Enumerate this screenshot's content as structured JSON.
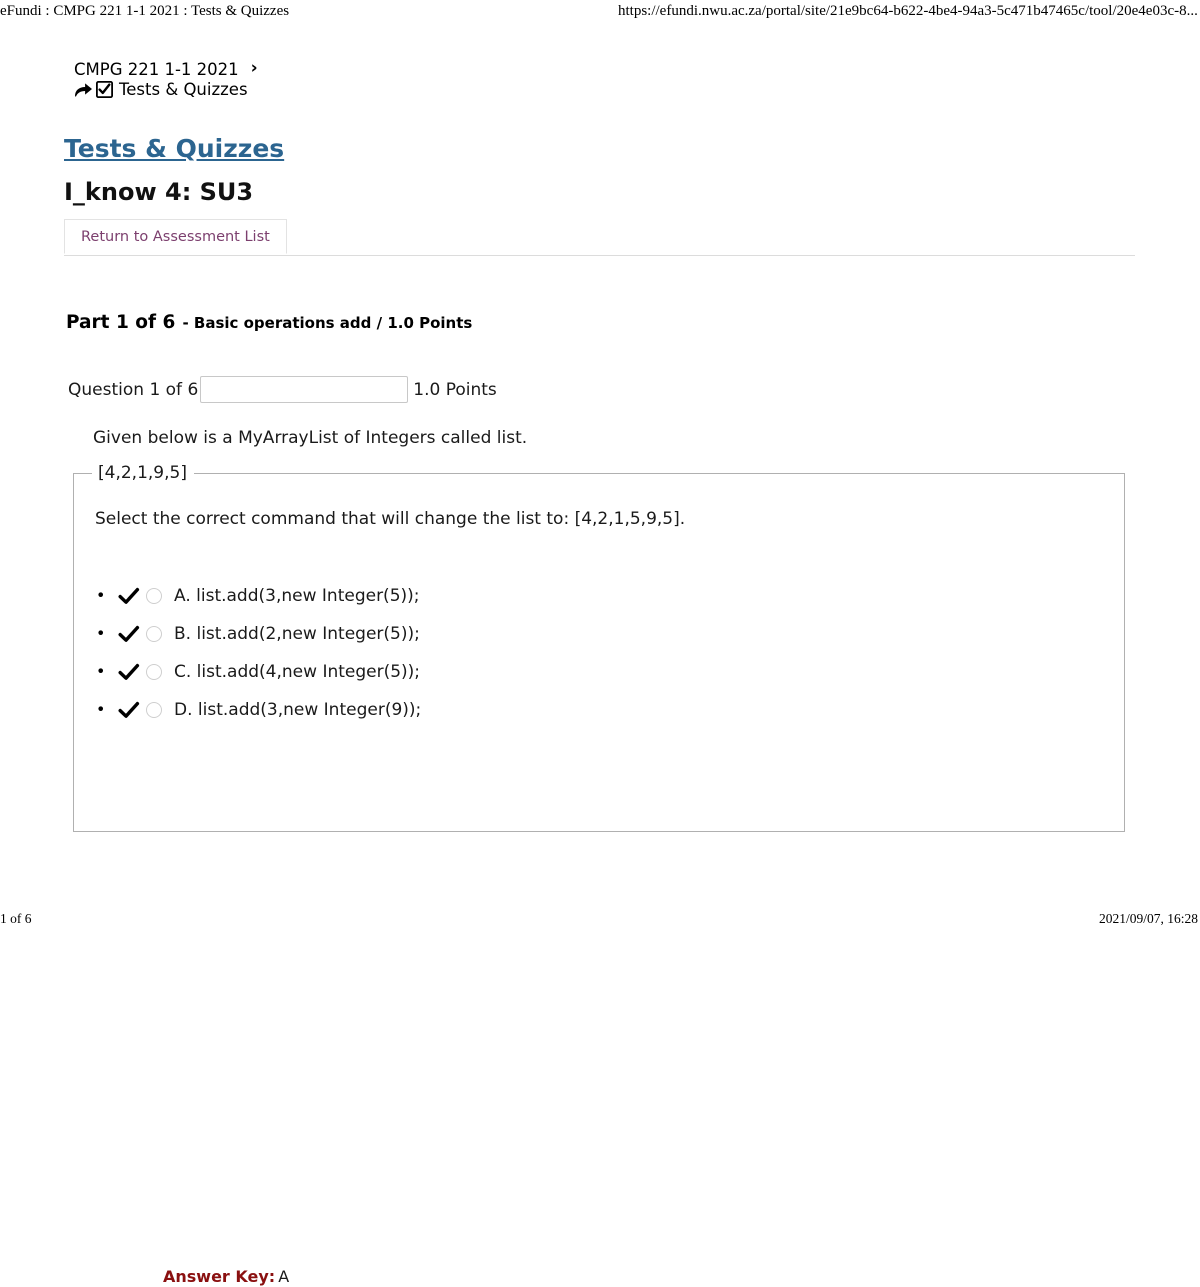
{
  "print": {
    "header_left": "eFundi : CMPG 221 1-1 2021 : Tests & Quizzes",
    "header_right": "https://efundi.nwu.ac.za/portal/site/21e9bc64-b622-4be4-94a3-5c471b47465c/tool/20e4e03c-8...",
    "footer_left": "1 of 6",
    "footer_right": "2021/09/07, 16:28"
  },
  "breadcrumb": {
    "site": "CMPG 221 1-1 2021",
    "separator": "›",
    "tool": "Tests & Quizzes",
    "arrow_icon": "arrow-right-curved-icon",
    "checkbox_icon": "checkbox-checked-icon"
  },
  "tool_title": "Tests & Quizzes",
  "assessment_title": "I_know 4: SU3",
  "tabs": {
    "return_label": "Return to Assessment List"
  },
  "part": {
    "heading": "Part 1 of 6",
    "subheading": "- Basic operations add / 1.0 Points"
  },
  "question": {
    "label": "Question 1 of 6",
    "input_value": "",
    "input_placeholder": "",
    "points": "1.0 Points",
    "stem": "Given below is a MyArrayList of Integers called list.",
    "legend": "[4,2,1,9,5]",
    "prompt": "Select the correct command that will change the list to: [4,2,1,5,9,5].",
    "options": [
      {
        "check_icon": "check-mark-icon",
        "label": "A. list.add(3,new Integer(5));"
      },
      {
        "check_icon": "check-mark-icon",
        "label": "B. list.add(2,new Integer(5));"
      },
      {
        "check_icon": "check-mark-icon",
        "label": "C. list.add(4,new Integer(5));"
      },
      {
        "check_icon": "check-mark-icon",
        "label": "D. list.add(3,new Integer(9));"
      }
    ],
    "answer_key_label": "Answer Key:",
    "answer_key_value": "A"
  },
  "colors": {
    "link_blue": "#2c6590",
    "tab_text": "#7c3f6e",
    "answer_key_red": "#8a1010",
    "fieldset_border": "#b0b0b0"
  }
}
